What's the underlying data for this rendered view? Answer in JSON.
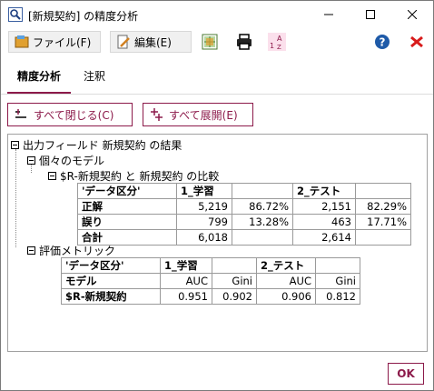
{
  "window": {
    "title": "[新規契約] の精度分析"
  },
  "toolbar": {
    "file_label": "ファイル(F)",
    "edit_label": "編集(E)"
  },
  "tabs": [
    {
      "label": "精度分析",
      "active": true
    },
    {
      "label": "注釈",
      "active": false
    }
  ],
  "actions": {
    "collapse_all": "すべて閉じる(C)",
    "expand_all": "すべて展開(E)"
  },
  "tree": {
    "root": "出力フィールド 新規契約 の結果",
    "individual_models": "個々のモデル",
    "comparison": "$R-新規契約 と 新規契約 の比較",
    "eval_metrics": "評価メトリック"
  },
  "comparison_table": {
    "header_label": "'データ区分'",
    "partitions": [
      "1_学習",
      "2_テスト"
    ],
    "rows": [
      {
        "label": "正解",
        "values": [
          "5,219",
          "86.72%",
          "2,151",
          "82.29%"
        ]
      },
      {
        "label": "誤り",
        "values": [
          "799",
          "13.28%",
          "463",
          "17.71%"
        ]
      },
      {
        "label": "合計",
        "values": [
          "6,018",
          "",
          "2,614",
          ""
        ]
      }
    ]
  },
  "metrics_table": {
    "header_label": "'データ区分'",
    "partitions": [
      "1_学習",
      "2_テスト"
    ],
    "model_label": "モデル",
    "metric_names": [
      "AUC",
      "Gini",
      "AUC",
      "Gini"
    ],
    "rows": [
      {
        "label": "$R-新規契約",
        "values": [
          "0.951",
          "0.902",
          "0.906",
          "0.812"
        ]
      }
    ]
  },
  "footer": {
    "ok_label": "OK"
  },
  "colors": {
    "accent": "#8c1a4a",
    "help_blue": "#1e5aa8",
    "close_red": "#d81b1b"
  }
}
